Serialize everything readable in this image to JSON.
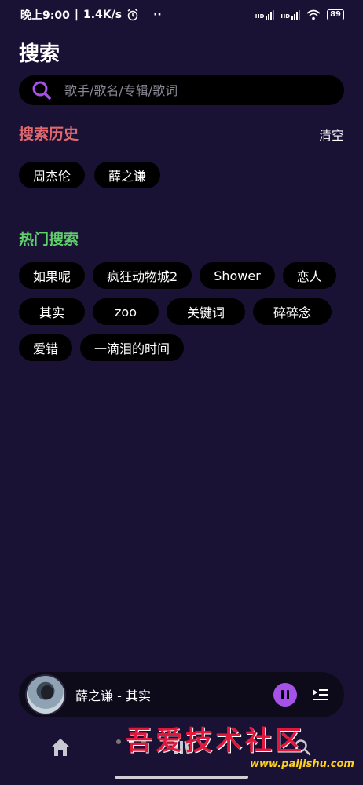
{
  "status_bar": {
    "time": "晚上9:00",
    "speed": "1.4K/s",
    "extra": "··",
    "signal1_label": "HD",
    "signal2_label": "HD",
    "battery": "89"
  },
  "page": {
    "title": "搜索"
  },
  "search": {
    "placeholder": "歌手/歌名/专辑/歌词"
  },
  "history": {
    "title": "搜索历史",
    "clear_label": "清空",
    "items": [
      "周杰伦",
      "薛之谦"
    ]
  },
  "hot": {
    "title": "热门搜索",
    "rows": [
      [
        "如果呢",
        "疯狂动物城2",
        "Shower",
        "恋人"
      ],
      [
        "其实",
        "zoo",
        "关键词",
        "碎碎念"
      ],
      [
        "爱错",
        "一滴泪的时间"
      ]
    ]
  },
  "player": {
    "now_playing": "薛之谦 - 其实",
    "state": "playing"
  },
  "bottom_nav": {
    "items": [
      "home-icon",
      "library-icon",
      "search-icon"
    ]
  },
  "watermark": {
    "text": "吾爱技术社区",
    "url": "www.paijishu.com"
  },
  "colors": {
    "background": "#1a1235",
    "accent": "#a652e8",
    "history_title": "#e0686e",
    "hot_title": "#5fd06a"
  }
}
